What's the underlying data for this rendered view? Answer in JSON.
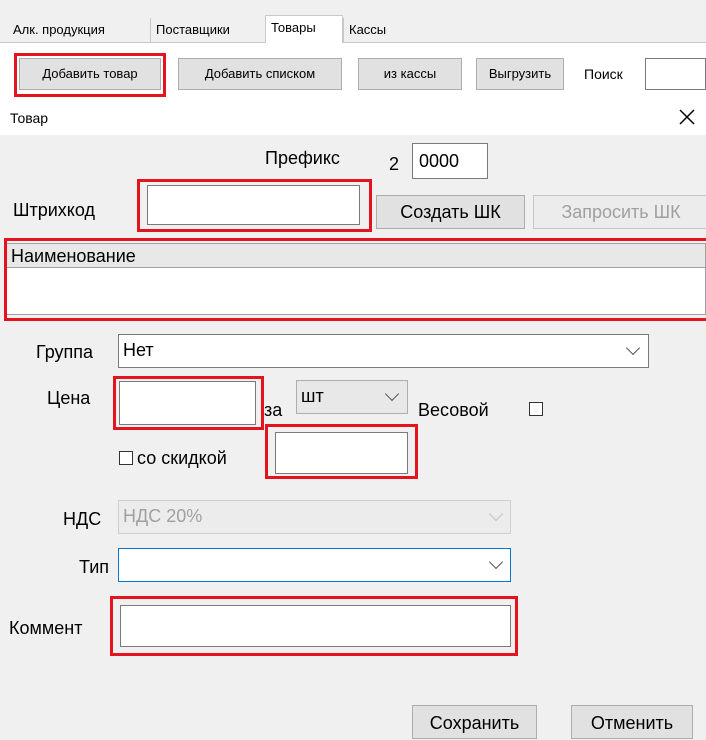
{
  "tabs": [
    {
      "label": "Алк. продукция"
    },
    {
      "label": "Поставщики"
    },
    {
      "label": "Товары",
      "active": true
    },
    {
      "label": "Кассы"
    }
  ],
  "toolbar": {
    "add_product": "Добавить товар",
    "add_list": "Добавить списком",
    "from_register": "из кассы",
    "export": "Выгрузить",
    "search_label": "Поиск",
    "search_value": ""
  },
  "dialog": {
    "title": "Товар",
    "close_icon": "close-icon",
    "prefix_label": "Префикс",
    "prefix_digit": "2",
    "prefix_value": "0000",
    "barcode_label": "Штрихкод",
    "barcode_value": "",
    "create_barcode": "Создать ШК",
    "request_barcode": "Запросить ШК",
    "name_label": "Наименование",
    "name_value": "",
    "group_label": "Группа",
    "group_value": "Нет",
    "price_label": "Цена",
    "price_value": "",
    "per_label": "за",
    "unit_value": "шт",
    "weight_label": "Весовой",
    "weight_checked": false,
    "discount_label": "со скидкой",
    "discount_checked": false,
    "discount_value": "",
    "vat_label": "НДС",
    "vat_value": "НДС 20%",
    "type_label": "Тип",
    "type_value": "",
    "comment_label": "Коммент",
    "comment_value": "",
    "save": "Сохранить",
    "cancel": "Отменить"
  },
  "colors": {
    "highlight": "#e3141f",
    "focus_border": "#0078d7",
    "disabled_text": "#a0a0a0"
  }
}
